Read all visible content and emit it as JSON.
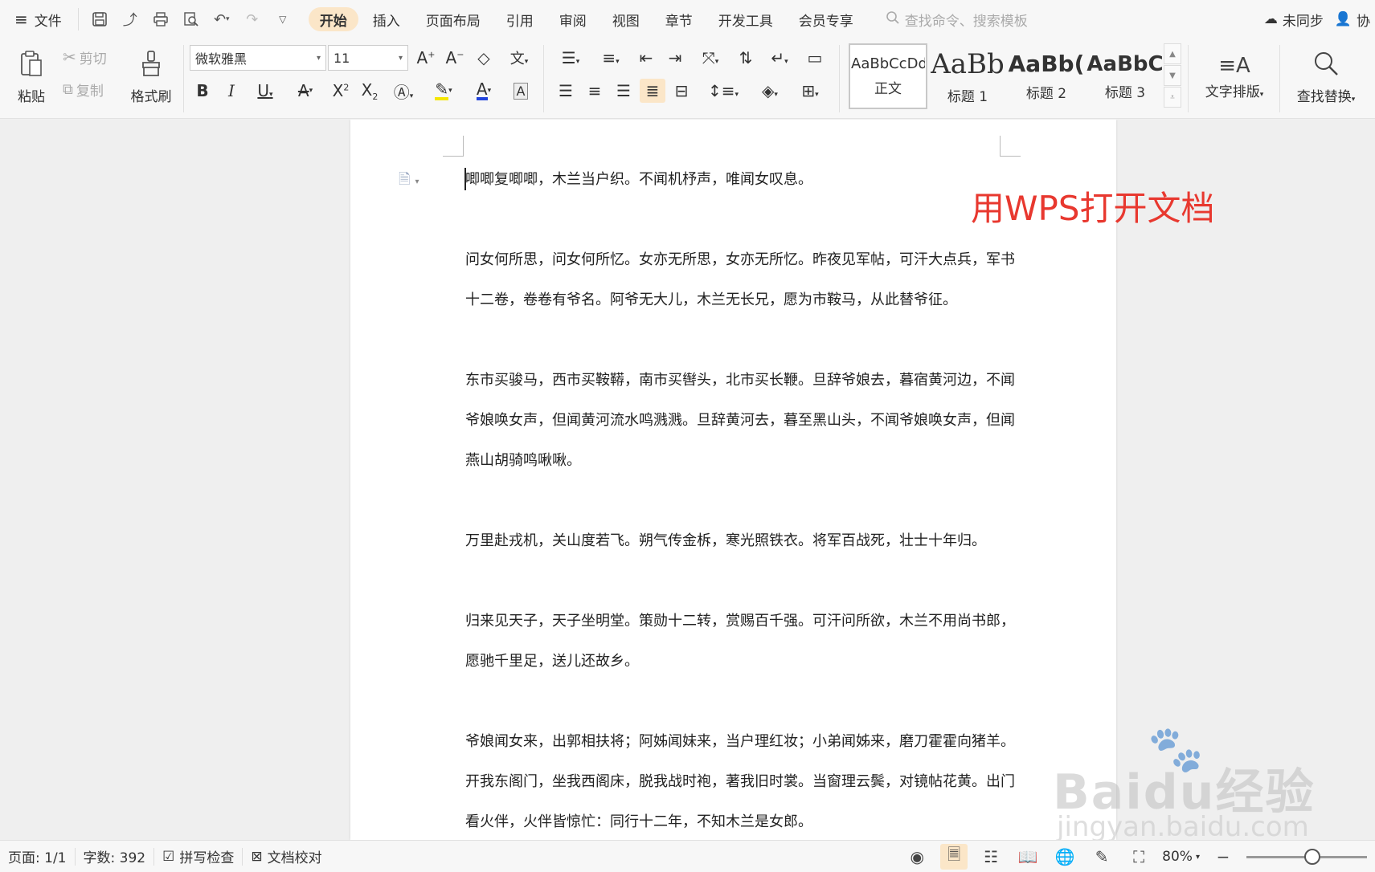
{
  "topbar": {
    "file_label": "文件",
    "tabs": [
      "开始",
      "插入",
      "页面布局",
      "引用",
      "审阅",
      "视图",
      "章节",
      "开发工具",
      "会员专享"
    ],
    "active_tab": "开始",
    "search_placeholder": "查找命令、搜索模板",
    "sync_label": "未同步",
    "collab_label": "协"
  },
  "ribbon": {
    "paste_label": "粘贴",
    "cut_label": "剪切",
    "copy_label": "复制",
    "format_painter_label": "格式刷",
    "font_name": "微软雅黑",
    "font_size": "11",
    "styles": [
      {
        "sample": "AaBbCcDd",
        "name": "正文"
      },
      {
        "sample": "AaBb",
        "name": "标题 1"
      },
      {
        "sample": "AaBb(",
        "name": "标题 2"
      },
      {
        "sample": "AaBbC",
        "name": "标题 3"
      }
    ],
    "text_layout_label": "文字排版",
    "find_replace_label": "查找替换"
  },
  "document": {
    "paragraphs": [
      [
        "唧唧复唧唧，木兰当户织。不闻机杼声，唯闻女叹息。"
      ],
      [
        "问女何所思，问女何所忆。女亦无所思，女亦无所忆。昨夜见军帖，可汗大点兵，军书",
        "十二卷，卷卷有爷名。阿爷无大儿，木兰无长兄，愿为市鞍马，从此替爷征。"
      ],
      [
        "东市买骏马，西市买鞍鞯，南市买辔头，北市买长鞭。旦辞爷娘去，暮宿黄河边，不闻",
        "爷娘唤女声，但闻黄河流水鸣溅溅。旦辞黄河去，暮至黑山头，不闻爷娘唤女声，但闻",
        "燕山胡骑鸣啾啾。"
      ],
      [
        "万里赴戎机，关山度若飞。朔气传金柝，寒光照铁衣。将军百战死，壮士十年归。"
      ],
      [
        "归来见天子，天子坐明堂。策勋十二转，赏赐百千强。可汗问所欲，木兰不用尚书郎，",
        "愿驰千里足，送儿还故乡。"
      ],
      [
        "爷娘闻女来，出郭相扶将；阿姊闻妹来，当户理红妆；小弟闻姊来，磨刀霍霍向猪羊。",
        "开我东阁门，坐我西阁床，脱我战时袍，著我旧时裳。当窗理云鬓，对镜帖花黄。出门",
        "看火伴，火伴皆惊忙：同行十二年，不知木兰是女郎。"
      ]
    ]
  },
  "annotation": "用WPS打开文档",
  "watermark": {
    "brand": "Baidu经验",
    "url": "jingyan.baidu.com"
  },
  "status": {
    "page": "页面: 1/1",
    "word_count": "字数: 392",
    "spell_check": "拼写检查",
    "proofread": "文档校对",
    "zoom": "80%"
  },
  "colors": {
    "accent": "#fbe6c8",
    "annotation": "#e8382f"
  }
}
